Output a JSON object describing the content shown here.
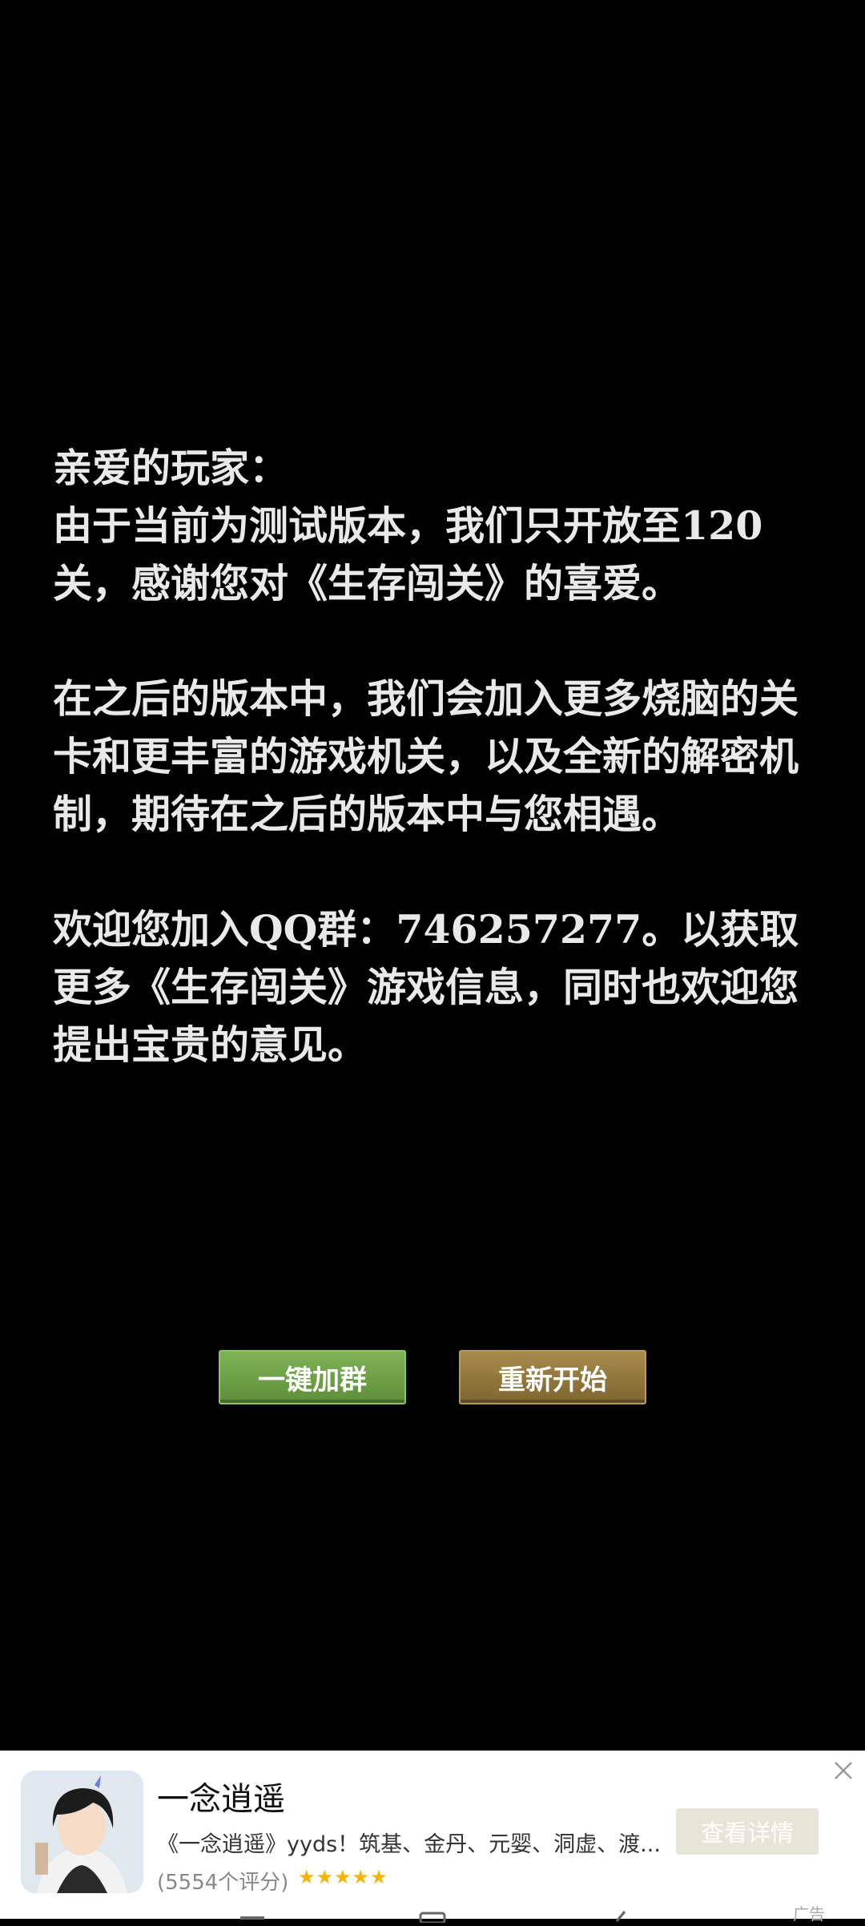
{
  "message": {
    "greeting": "亲爱的玩家：",
    "paragraph1": "由于当前为测试版本，我们只开放至120关，感谢您对《生存闯关》的喜爱。",
    "paragraph2": "在之后的版本中，我们会加入更多烧脑的关卡和更丰富的游戏机关，以及全新的解密机制，期待在之后的版本中与您相遇。",
    "paragraph3": "欢迎您加入QQ群：746257277。以获取更多《生存闯关》游戏信息，同时也欢迎您提出宝贵的意见。"
  },
  "buttons": {
    "join_group": "一键加群",
    "restart": "重新开始"
  },
  "ad": {
    "title": "一念逍遥",
    "description": "《一念逍遥》yyds！筑基、金丹、元婴、洞虚、渡...",
    "rating": "(5554个评分)",
    "stars": "★★★★★",
    "cta": "查看详情",
    "label": "广告",
    "close_icon": "close-icon",
    "avatar_icon": "game-avatar-icon"
  },
  "colors": {
    "background": "#000000",
    "text": "#e9e9e9",
    "button_green": "#6ea047",
    "button_brown": "#94783e",
    "star": "#f4b400"
  }
}
